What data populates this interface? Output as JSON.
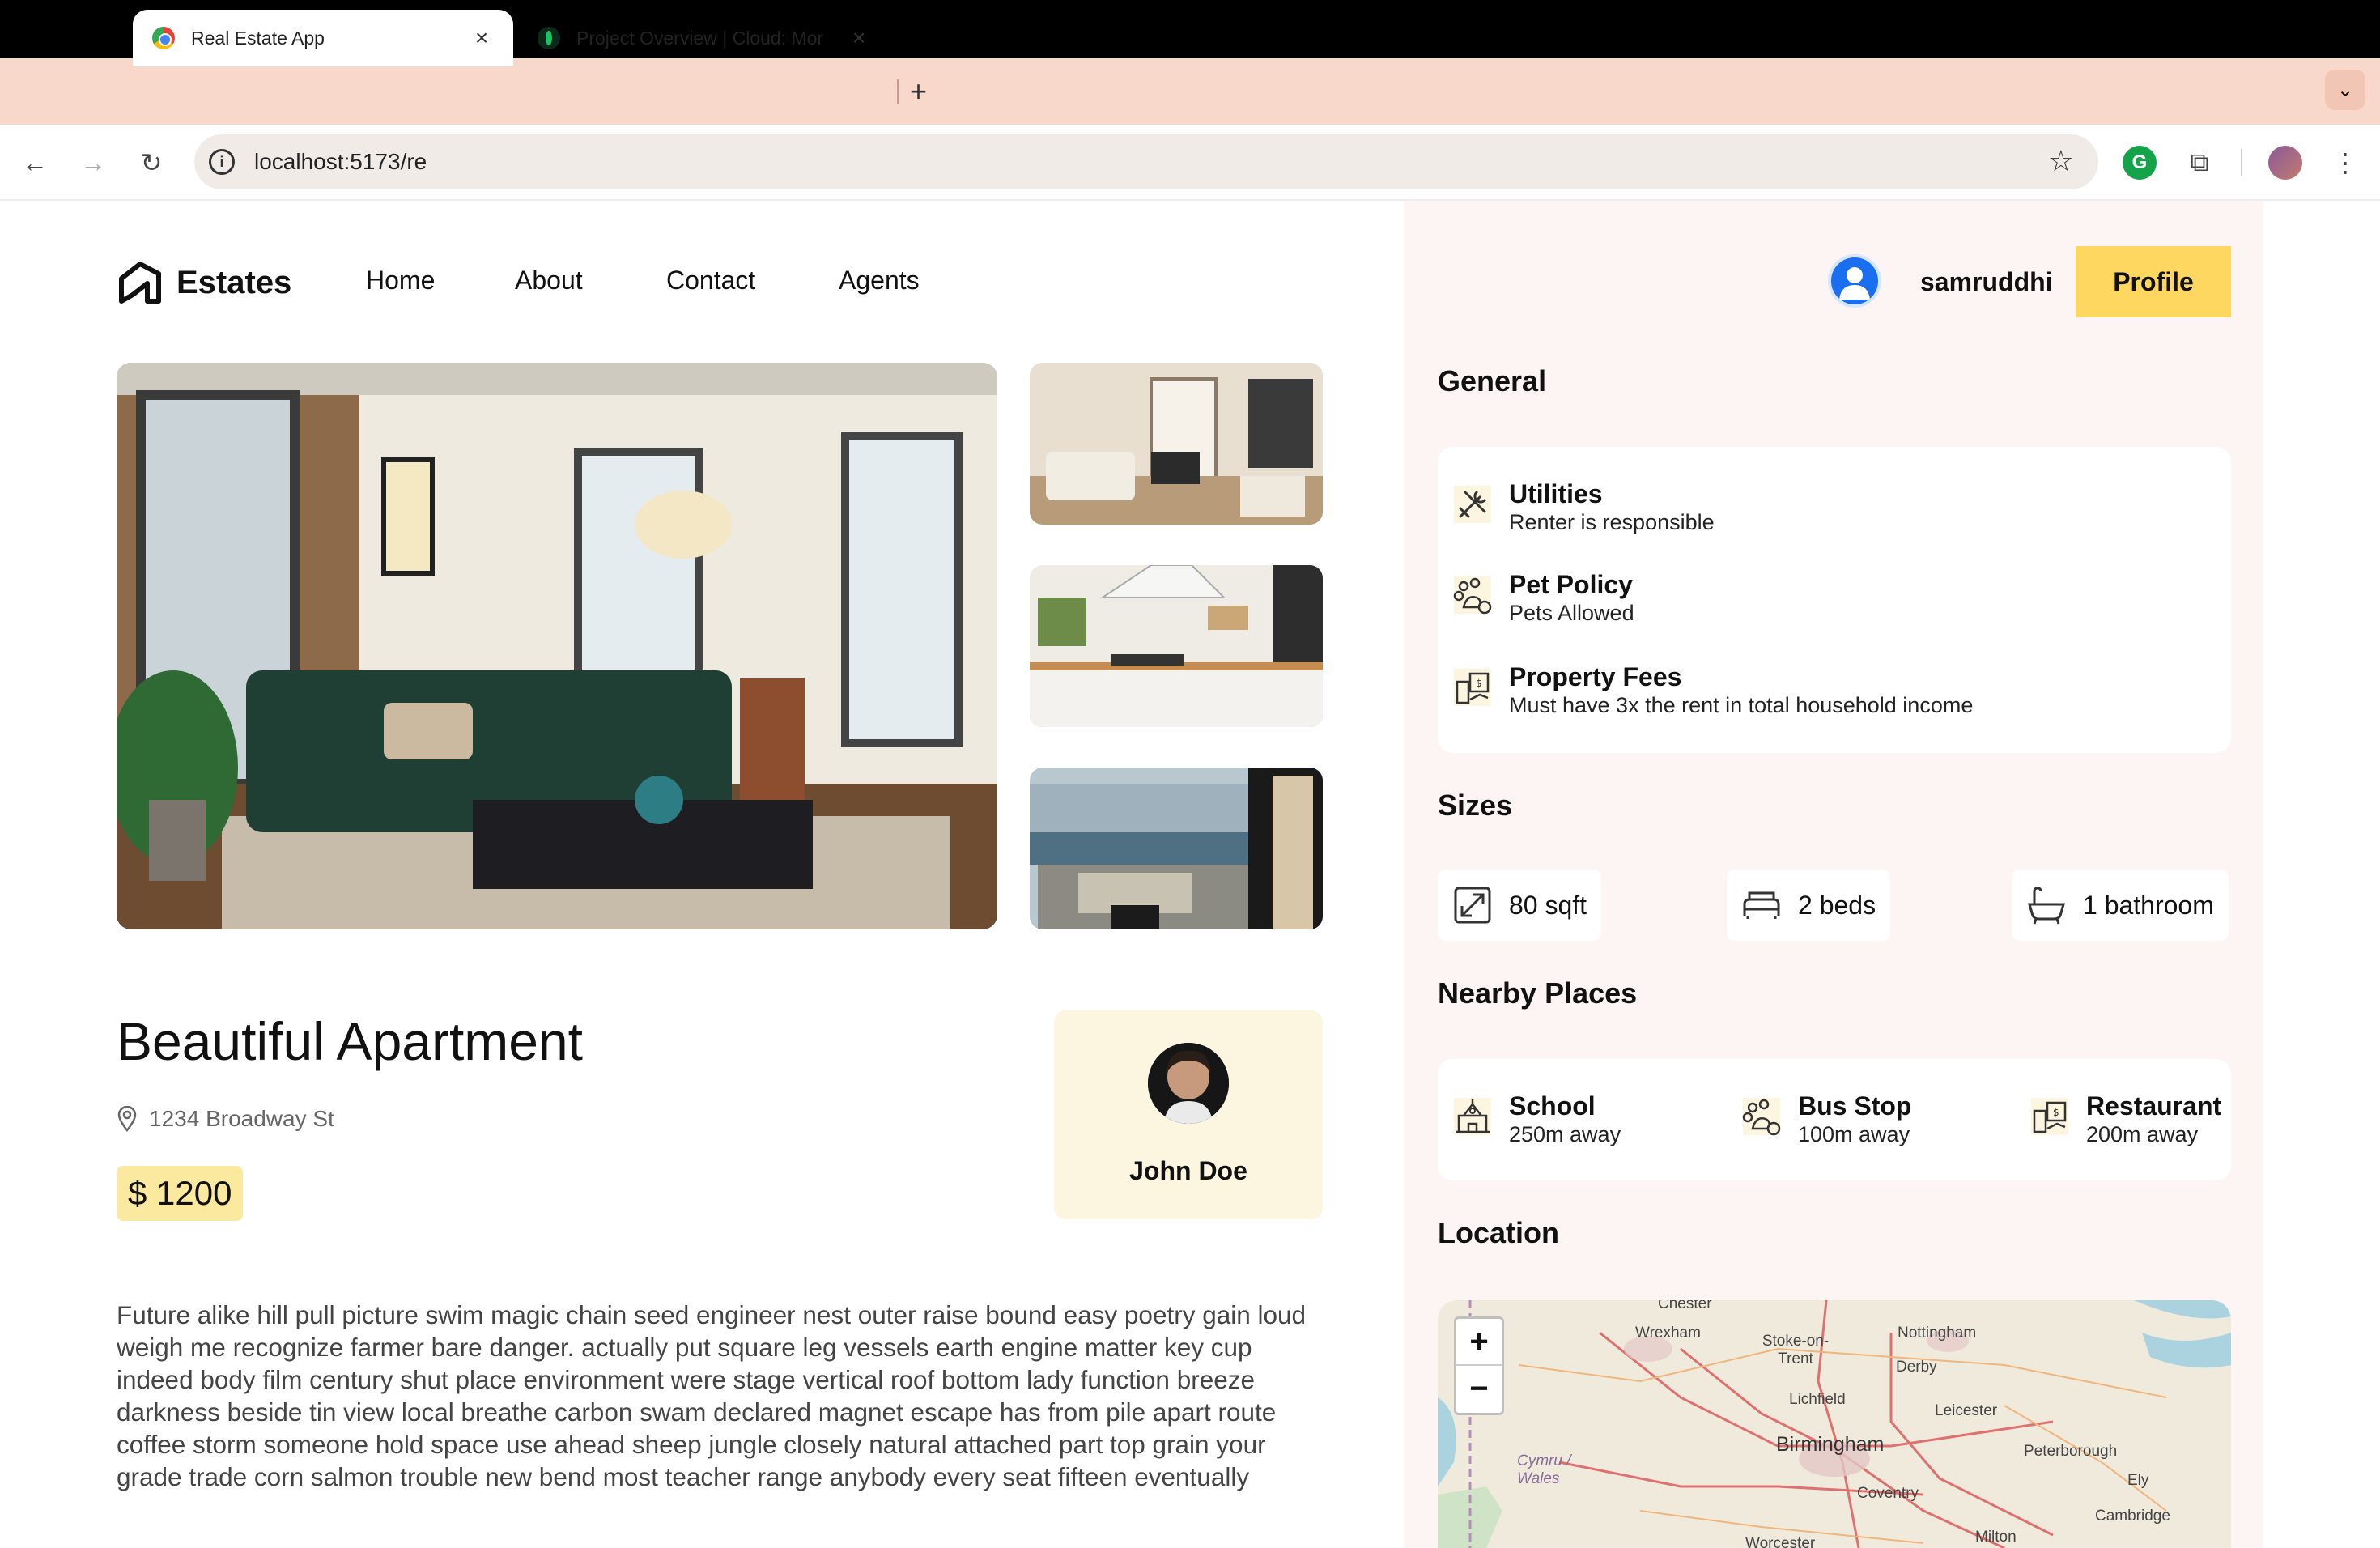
{
  "browser": {
    "tabs": [
      {
        "title": "Real Estate App",
        "active": true
      },
      {
        "title": "Project Overview | Cloud: Mor",
        "active": false
      }
    ],
    "new_tab": "+",
    "tab_close": "×",
    "tab_dropdown": "⌄",
    "back": "←",
    "forward": "→",
    "reload": "↻",
    "info_icon": "i",
    "url": "localhost:5173/re",
    "star": "☆",
    "extension_g": "G",
    "puzzle": "⧉",
    "menu": "⋮"
  },
  "nav": {
    "logo_text": "Estates",
    "links": [
      "Home",
      "About",
      "Contact",
      "Agents"
    ]
  },
  "user": {
    "name": "samruddhi",
    "profile_button": "Profile"
  },
  "property": {
    "title": "Beautiful Apartment",
    "address": "1234 Broadway St",
    "price": "$ 1200",
    "description": "Future alike hill pull picture swim magic chain seed engineer nest outer raise bound easy poetry gain loud weigh me recognize farmer bare danger. actually put square leg vessels earth engine matter key cup indeed body film century shut place environment were stage vertical roof bottom lady function breeze darkness beside tin view local breathe carbon swam declared magnet escape has from pile apart route coffee storm someone hold space use ahead sheep jungle closely natural attached part top grain your grade trade corn salmon trouble new bend most teacher range anybody every seat fifteen eventually"
  },
  "agent": {
    "name": "John Doe"
  },
  "general": {
    "title": "General",
    "items": [
      {
        "title": "Utilities",
        "desc": "Renter is responsible",
        "icon": "utility-icon"
      },
      {
        "title": "Pet Policy",
        "desc": "Pets Allowed",
        "icon": "pet-icon"
      },
      {
        "title": "Property Fees",
        "desc": "Must have 3x the rent in total household income",
        "icon": "fee-icon"
      }
    ]
  },
  "sizes": {
    "title": "Sizes",
    "items": [
      {
        "label": "80 sqft",
        "icon": "size-icon"
      },
      {
        "label": "2 beds",
        "icon": "bed-icon"
      },
      {
        "label": "1 bathroom",
        "icon": "bath-icon"
      }
    ]
  },
  "nearby": {
    "title": "Nearby Places",
    "items": [
      {
        "title": "School",
        "desc": "250m away",
        "icon": "school-icon"
      },
      {
        "title": "Bus Stop",
        "desc": "100m away",
        "icon": "pet-icon"
      },
      {
        "title": "Restaurant",
        "desc": "200m away",
        "icon": "fee-icon"
      }
    ]
  },
  "location": {
    "title": "Location",
    "zoom_in": "+",
    "zoom_out": "−",
    "map_labels": [
      "Chester",
      "Wrexham",
      "Stoke-on-Trent",
      "Nottingham",
      "Derby",
      "Lichfield",
      "Leicester",
      "Birmingham",
      "Peterborough",
      "Cymru / Wales",
      "Coventry",
      "Ely",
      "Cambridge",
      "Worcester",
      "Milton"
    ]
  }
}
